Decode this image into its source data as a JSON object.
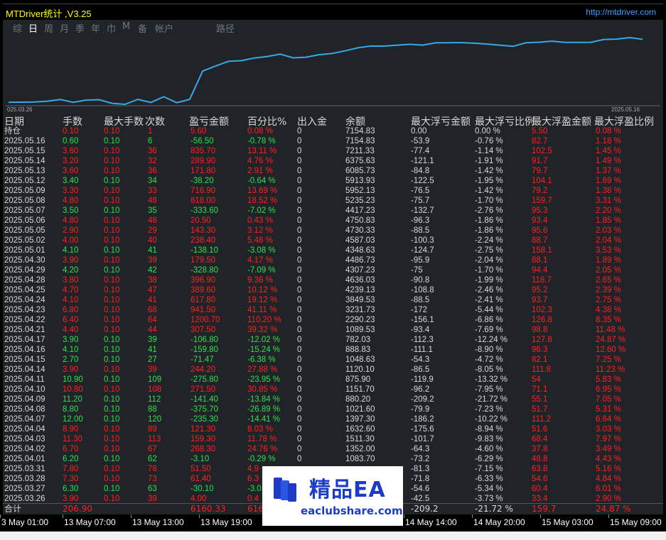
{
  "window": {
    "title": "MTDriver统计 ,V3.25",
    "url": "http://mtdriver.com"
  },
  "tabs": [
    "综",
    "日",
    "周",
    "月",
    "季",
    "年",
    "巾",
    "M",
    "备",
    "帐户",
    "路径"
  ],
  "active_tab": 1,
  "chart_data": {
    "type": "line",
    "x_start_label": "025.03.26",
    "x_end_label": "2025.05.16",
    "color": "#39a8e8",
    "values": [
      0,
      4.0,
      10.4,
      41.1,
      102.2,
      -0.94,
      82.41,
      93.27,
      -38.2,
      -73.8,
      106.9,
      -7.7,
      203.9,
      -15.3,
      108.4,
      1138.9,
      1321.53,
      1494.53,
      1517.5,
      1616.13,
      1670.23,
      1757.23,
      1621.13,
      1643.93,
      1736.33,
      1778.93,
      1874.73,
      1985.93,
      2051.33,
      2048.13,
      2081.43,
      2116.63,
      2085.73,
      2167.43,
      2172.33,
      2176.43,
      2155.73,
      2123.93,
      2079.93,
      2041.63,
      2174.33,
      2190.73,
      2231.13,
      2183.13,
      2186.83,
      2188.13,
      2292.83,
      2305.33,
      2359.43,
      2297.63
    ],
    "xlabel": "",
    "ylabel": ""
  },
  "table": {
    "headers": [
      "日期",
      "手数",
      "最大手数",
      "次数",
      "盈亏金额",
      "百分比%",
      "出入金",
      "余额",
      "最大浮亏金额",
      "最大浮亏比例",
      "最大浮盈金额",
      "最大浮盈比例"
    ],
    "rows": [
      [
        "持仓",
        "0.10",
        "0.10",
        "1",
        "5.60",
        "0.08 %",
        "0",
        "7154.83",
        "0.00",
        "0.00 %",
        "5.50",
        "0.08 %"
      ],
      [
        "2025.05.16",
        "0.60",
        "0.10",
        "6",
        "-56.50",
        "-0.78 %",
        "0",
        "7154.83",
        "-53.9",
        "-0.76 %",
        "82.7",
        "1.18 %"
      ],
      [
        "2025.05.15",
        "3.60",
        "0.10",
        "36",
        "835.70",
        "13.11 %",
        "0",
        "7211.33",
        "-77.4",
        "-1.14 %",
        "102.5",
        "1.45 %"
      ],
      [
        "2025.05.14",
        "3.20",
        "0.10",
        "32",
        "289.90",
        "4.76 %",
        "0",
        "6375.63",
        "-121.1",
        "-1.91 %",
        "91.7",
        "1.49 %"
      ],
      [
        "2025.05.13",
        "3.60",
        "0.10",
        "36",
        "171.80",
        "2.91 %",
        "0",
        "6085.73",
        "-84.8",
        "-1.42 %",
        "79.7",
        "1.37 %"
      ],
      [
        "2025.05.12",
        "3.40",
        "0.10",
        "34",
        "-38.20",
        "-0.64 %",
        "0",
        "5913.93",
        "-122.5",
        "-1.95 %",
        "104.1",
        "1.69 %"
      ],
      [
        "2025.05.09",
        "3.30",
        "0.10",
        "33",
        "716.90",
        "13.69 %",
        "0",
        "5952.13",
        "-76.5",
        "-1.42 %",
        "79.2",
        "1.38 %"
      ],
      [
        "2025.05.08",
        "4.80",
        "0.10",
        "48",
        "818.00",
        "18.52 %",
        "0",
        "5235.23",
        "-75.7",
        "-1.70 %",
        "159.7",
        "3.31 %"
      ],
      [
        "2025.05.07",
        "3.50",
        "0.10",
        "35",
        "-333.60",
        "-7.02 %",
        "0",
        "4417.23",
        "-132.7",
        "-2.76 %",
        "95.3",
        "2.20 %"
      ],
      [
        "2025.05.06",
        "4.80",
        "0.10",
        "48",
        "20.50",
        "0.43 %",
        "0",
        "4750.83",
        "-96.3",
        "-1.86 %",
        "93.4",
        "1.85 %"
      ],
      [
        "2025.05.05",
        "2.90",
        "0.10",
        "29",
        "143.30",
        "3.12 %",
        "0",
        "4730.33",
        "-88.5",
        "-1.86 %",
        "95.6",
        "2.03 %"
      ],
      [
        "2025.05.02",
        "4.00",
        "0.10",
        "40",
        "238.40",
        "5.48 %",
        "0",
        "4587.03",
        "-100.3",
        "-2.24 %",
        "88.7",
        "2.04 %"
      ],
      [
        "2025.05.01",
        "4.10",
        "0.10",
        "41",
        "-138.10",
        "-3.08 %",
        "0",
        "4348.63",
        "-124.7",
        "-2.75 %",
        "158.1",
        "3.53 %"
      ],
      [
        "2025.04.30",
        "3.90",
        "0.10",
        "39",
        "179.50",
        "4.17 %",
        "0",
        "4486.73",
        "-95.9",
        "-2.04 %",
        "88.1",
        "1.89 %"
      ],
      [
        "2025.04.29",
        "4.20",
        "0.10",
        "42",
        "-328.80",
        "-7.09 %",
        "0",
        "4307.23",
        "-75",
        "-1.70 %",
        "94.4",
        "2.05 %"
      ],
      [
        "2025.04.28",
        "3.80",
        "0.10",
        "38",
        "396.90",
        "9.36 %",
        "0",
        "4636.03",
        "-90.8",
        "-1.99 %",
        "118.7",
        "2.65 %"
      ],
      [
        "2025.04.25",
        "4.70",
        "0.10",
        "47",
        "389.60",
        "10.12 %",
        "0",
        "4239.13",
        "-108.8",
        "-2.46 %",
        "95.2",
        "2.39 %"
      ],
      [
        "2025.04.24",
        "4.10",
        "0.10",
        "41",
        "617.80",
        "19.12 %",
        "0",
        "3849.53",
        "-88.5",
        "-2.41 %",
        "93.7",
        "2.75 %"
      ],
      [
        "2025.04.23",
        "6.80",
        "0.10",
        "68",
        "941.50",
        "41.11 %",
        "0",
        "3231.73",
        "-172",
        "-5.44 %",
        "102.3",
        "4.38 %"
      ],
      [
        "2025.04.22",
        "6.40",
        "0.10",
        "64",
        "1200.70",
        "110.20 %",
        "0",
        "2290.23",
        "-156.1",
        "-6.86 %",
        "126.8",
        "8.35 %"
      ],
      [
        "2025.04.21",
        "4.40",
        "0.10",
        "44",
        "307.50",
        "39.32 %",
        "0",
        "1089.53",
        "-93.4",
        "-7.69 %",
        "98.8",
        "11.48 %"
      ],
      [
        "2025.04.17",
        "3.90",
        "0.10",
        "39",
        "-106.80",
        "-12.02 %",
        "0",
        "782.03",
        "-112.3",
        "-12.24 %",
        "127.8",
        "24.87 %"
      ],
      [
        "2025.04.16",
        "4.10",
        "0.10",
        "41",
        "-159.80",
        "-15.24 %",
        "0",
        "888.83",
        "-111.1",
        "-8.90 %",
        "96.3",
        "12.60 %"
      ],
      [
        "2025.04.15",
        "2.70",
        "0.10",
        "27",
        "-71.47",
        "-6.38 %",
        "0",
        "1048.63",
        "-54.3",
        "-4.72 %",
        "82.1",
        "7.25 %"
      ],
      [
        "2025.04.14",
        "3.90",
        "0.10",
        "39",
        "244.20",
        "27.88 %",
        "0",
        "1120.10",
        "-86.5",
        "-8.05 %",
        "111.8",
        "11.23 %"
      ],
      [
        "2025.04.11",
        "10.90",
        "0.10",
        "109",
        "-275.80",
        "-23.95 %",
        "0",
        "875.90",
        "-119.9",
        "-13.32 %",
        "54",
        "5.83 %"
      ],
      [
        "2025.04.10",
        "10.80",
        "0.10",
        "108",
        "271.50",
        "30.85 %",
        "0",
        "1151.70",
        "-96.2",
        "-7.95 %",
        "71.1",
        "6.95 %"
      ],
      [
        "2025.04.09",
        "11.20",
        "0.10",
        "112",
        "-141.40",
        "-13.84 %",
        "0",
        "880.20",
        "-209.2",
        "-21.72 %",
        "55.1",
        "7.05 %"
      ],
      [
        "2025.04.08",
        "8.80",
        "0.10",
        "88",
        "-375.70",
        "-26.89 %",
        "0",
        "1021.60",
        "-79.9",
        "-7.23 %",
        "51.7",
        "5.31 %"
      ],
      [
        "2025.04.07",
        "12.00",
        "0.10",
        "120",
        "-235.30",
        "-14.41 %",
        "0",
        "1397.30",
        "-186.2",
        "-10.22 %",
        "111.2",
        "6.64 %"
      ],
      [
        "2025.04.04",
        "8.90",
        "0.10",
        "89",
        "121.30",
        "8.03 %",
        "0",
        "1632.60",
        "-175.6",
        "-8.94 %",
        "51.6",
        "3.03 %"
      ],
      [
        "2025.04.03",
        "11.30",
        "0.10",
        "113",
        "159.30",
        "11.78 %",
        "0",
        "1511.30",
        "-101.7",
        "-9.83 %",
        "68.4",
        "7.97 %"
      ],
      [
        "2025.04.02",
        "6.70",
        "0.10",
        "67",
        "268.30",
        "24.76 %",
        "0",
        "1352.00",
        "-64.3",
        "-4.60 %",
        "37.8",
        "3.49 %"
      ],
      [
        "2025.04.01",
        "6.20",
        "0.10",
        "62",
        "-3.10",
        "-0.29 %",
        "0",
        "1083.70",
        "-73.2",
        "-6.29 %",
        "48.8",
        "4.43 %"
      ],
      [
        "2025.03.31",
        "7.80",
        "0.10",
        "78",
        "51.50",
        "4.9",
        "",
        "",
        "-81.3",
        "-7.15 %",
        "63.8",
        "5.16 %"
      ],
      [
        "2025.03.28",
        "7.30",
        "0.10",
        "73",
        "61.40",
        "6.3",
        "",
        "",
        "-71.8",
        "-6.33 %",
        "54.6",
        "4.84 %"
      ],
      [
        "2025.03.27",
        "6.30",
        "0.10",
        "63",
        "-30.10",
        "-3.0",
        "",
        "",
        "-54.6",
        "-5.34 %",
        "60.4",
        "6.01 %"
      ],
      [
        "2025.03.26",
        "3.90",
        "0.10",
        "39",
        "4.00",
        "0.4",
        "",
        "",
        "-42.5",
        "-3.73 %",
        "33.4",
        "2.90 %"
      ]
    ],
    "summary": [
      "合计",
      "206.90",
      "",
      "",
      "6160.33",
      "616",
      "",
      "",
      "-209.2",
      "-21.72 %",
      "159.7",
      "24.87 %"
    ]
  },
  "time_axis": [
    "3 May 01:00",
    "13 May 07:00",
    "13 May 13:00",
    "13 May 19:00",
    "14 May 14:00",
    "14 May 20:00",
    "15 May 03:00",
    "15 May 09:00"
  ],
  "watermark": {
    "title": "精品EA",
    "site": "eaclubshare.com"
  }
}
